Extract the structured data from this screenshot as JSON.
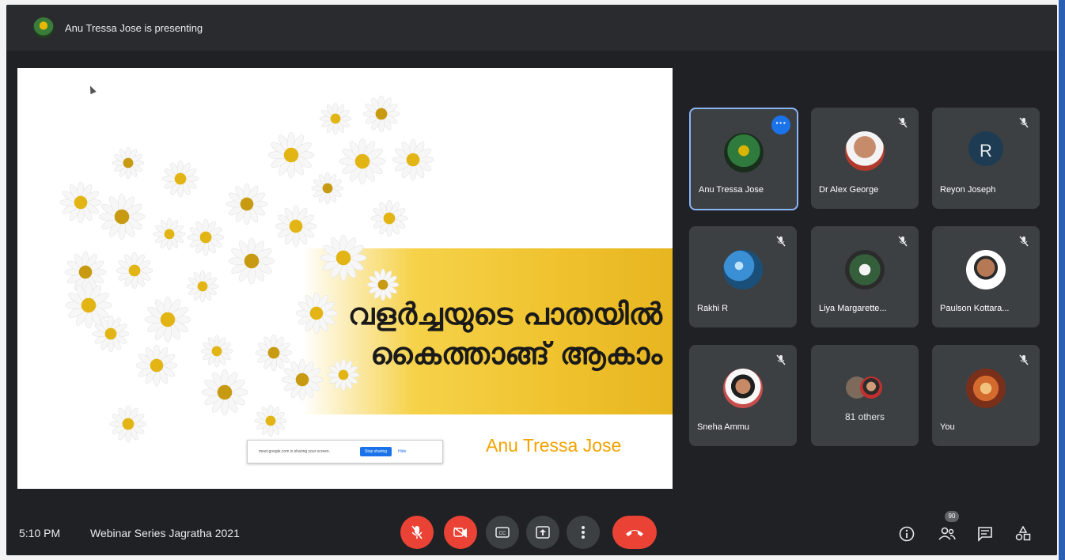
{
  "topbar": {
    "presenting_text": "Anu Tressa Jose is presenting"
  },
  "slide": {
    "title_line1": "വളർച്ചയുടെ പാതയിൽ",
    "title_line2": "കൈത്താങ്ങ് ആകാം",
    "author": "Anu Tressa Jose",
    "share_bar": {
      "text": "meet.google.com is sharing your screen.",
      "stop_label": "Stop sharing",
      "hide_label": "Hide"
    }
  },
  "participants": [
    {
      "name": "Anu Tressa Jose",
      "avatar": "photo",
      "muted": false,
      "active": true
    },
    {
      "name": "Dr Alex George",
      "avatar": "photo",
      "muted": true
    },
    {
      "name": "Reyon Joseph",
      "avatar_letter": "R",
      "muted": true
    },
    {
      "name": "Rakhi R",
      "avatar": "photo",
      "muted": true
    },
    {
      "name": "Liya Margarette...",
      "avatar": "photo",
      "muted": true
    },
    {
      "name": "Paulson Kottara...",
      "avatar": "photo",
      "muted": true
    },
    {
      "name": "Sneha Ammu",
      "avatar": "photo",
      "muted": true
    },
    {
      "name": "81 others",
      "avatar": "photo-pair"
    },
    {
      "name": "You",
      "avatar": "photo",
      "muted": true
    }
  ],
  "bottombar": {
    "time": "5:10 PM",
    "meeting_title": "Webinar Series Jagratha 2021",
    "participant_count": "90",
    "controls": [
      "mic-off",
      "camera-off",
      "captions",
      "present",
      "more",
      "hangup"
    ],
    "right_icons": [
      "info",
      "people",
      "chat",
      "activities"
    ]
  },
  "colors": {
    "background": "#202124",
    "tile": "#3c4043",
    "red": "#ea4335",
    "accent": "#1a73e8",
    "author_text": "#f2a300"
  }
}
